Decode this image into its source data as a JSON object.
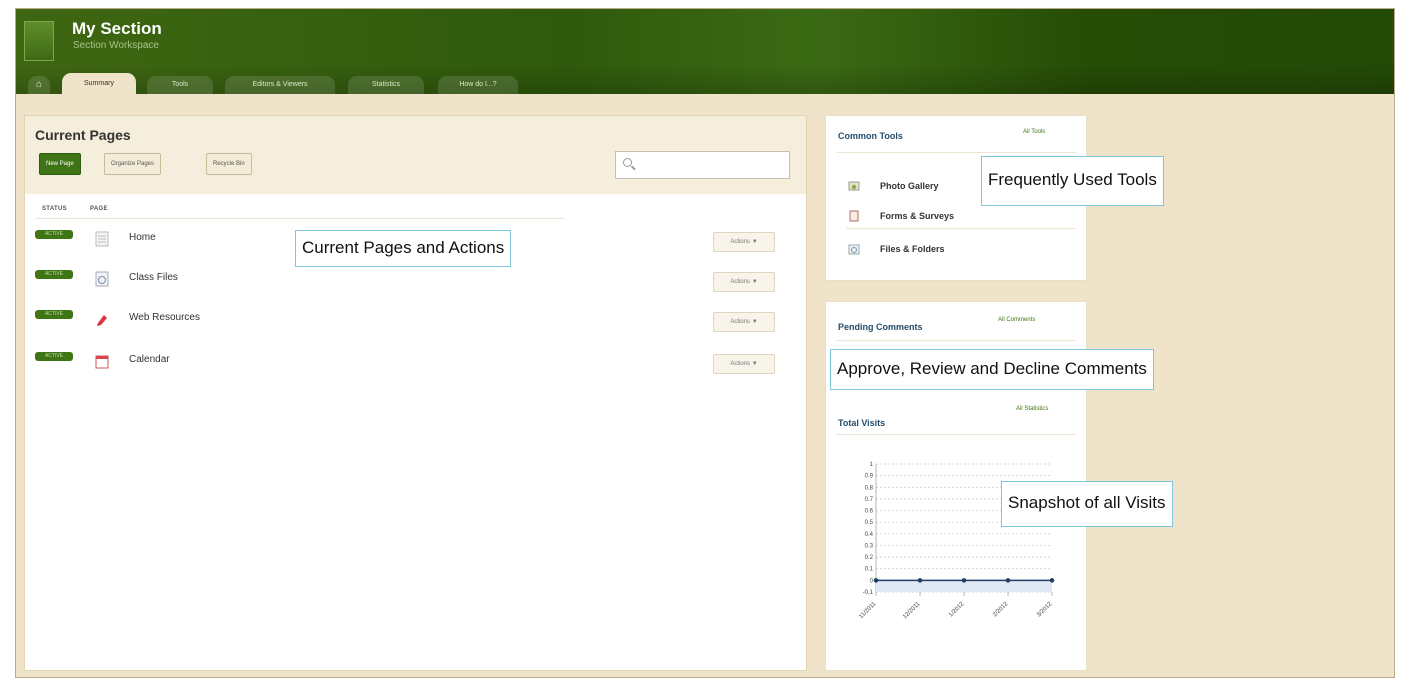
{
  "header": {
    "title": "My Section",
    "subtitle": "Section Workspace",
    "tabs": [
      {
        "label": "Summary",
        "active": true
      },
      {
        "label": "Tools",
        "active": false
      },
      {
        "label": "Editors & Viewers",
        "active": false
      },
      {
        "label": "Statistics",
        "active": false
      },
      {
        "label": "How do I...?",
        "active": false
      }
    ]
  },
  "current_pages": {
    "title": "Current Pages",
    "buttons": {
      "new_page": "New Page",
      "organize": "Organize Pages",
      "recycle": "Recycle Bin"
    },
    "search": {
      "value": "",
      "placeholder": ""
    },
    "columns": {
      "status": "STATUS",
      "page": "PAGE"
    },
    "rows": [
      {
        "status": "ACTIVE",
        "icon": "page-icon",
        "label": "Home",
        "action": "Actions ▼"
      },
      {
        "status": "ACTIVE",
        "icon": "files-icon",
        "label": "Class Files",
        "action": "Actions ▼"
      },
      {
        "status": "ACTIVE",
        "icon": "web-resources-icon",
        "label": "Web Resources",
        "action": "Actions ▼"
      },
      {
        "status": "ACTIVE",
        "icon": "calendar-icon",
        "label": "Calendar",
        "action": "Actions ▼"
      }
    ]
  },
  "common_tools": {
    "title": "Common Tools",
    "link": "All Tools",
    "items": [
      {
        "icon": "photo-gallery-icon",
        "label": "Photo Gallery"
      },
      {
        "icon": "forms-surveys-icon",
        "label": "Forms & Surveys"
      },
      {
        "icon": "files-folders-icon",
        "label": "Files & Folders"
      }
    ]
  },
  "pending_comments": {
    "title": "Pending Comments",
    "link": "All Comments"
  },
  "total_visits": {
    "title": "Total Visits",
    "link": "All Statistics"
  },
  "callouts": {
    "current_pages": "Current Pages and Actions",
    "tools": "Frequently Used Tools",
    "comments": "Approve, Review and Decline Comments",
    "visits": "Snapshot of all Visits"
  },
  "chart_data": {
    "type": "line",
    "categories": [
      "11/2011",
      "12/2011",
      "1/2012",
      "2/2012",
      "3/2012"
    ],
    "series": [
      {
        "values": [
          0,
          0,
          0,
          0,
          0
        ]
      }
    ],
    "ylim": [
      -0.1,
      1
    ],
    "yticks": [
      "1",
      "0.9",
      "0.8",
      "0.7",
      "0.6",
      "0.5",
      "0.4",
      "0.3",
      "0.2",
      "0.1",
      "0",
      "-0.1"
    ],
    "grid": true,
    "legend": "none",
    "colors": {
      "line": "#1f3f66",
      "fill": "#dfe9f4",
      "grid": "#c8c8c8"
    }
  }
}
